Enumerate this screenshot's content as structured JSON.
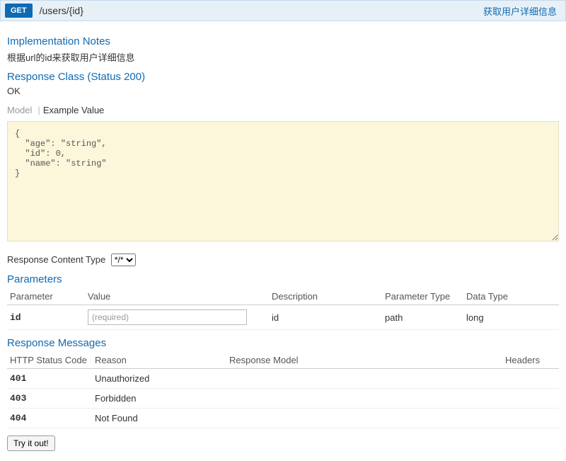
{
  "operation": {
    "method": "GET",
    "path": "/users/{id}",
    "summary": "获取用户详细信息"
  },
  "notes": {
    "heading": "Implementation Notes",
    "text": "根据url的id来获取用户详细信息"
  },
  "response_class": {
    "heading": "Response Class (Status 200)",
    "status_text": "OK",
    "tabs": {
      "model": "Model",
      "example": "Example Value"
    },
    "example": "{\n  \"age\": \"string\",\n  \"id\": 0,\n  \"name\": \"string\"\n}"
  },
  "content_type": {
    "label": "Response Content Type",
    "options": [
      "*/*"
    ],
    "selected": "*/*"
  },
  "parameters": {
    "heading": "Parameters",
    "columns": {
      "parameter": "Parameter",
      "value": "Value",
      "description": "Description",
      "param_type": "Parameter Type",
      "data_type": "Data Type"
    },
    "rows": [
      {
        "name": "id",
        "placeholder": "(required)",
        "value": "",
        "description": "id",
        "param_type": "path",
        "data_type": "long"
      }
    ]
  },
  "response_messages": {
    "heading": "Response Messages",
    "columns": {
      "code": "HTTP Status Code",
      "reason": "Reason",
      "model": "Response Model",
      "headers": "Headers"
    },
    "rows": [
      {
        "code": "401",
        "reason": "Unauthorized",
        "model": "",
        "headers": ""
      },
      {
        "code": "403",
        "reason": "Forbidden",
        "model": "",
        "headers": ""
      },
      {
        "code": "404",
        "reason": "Not Found",
        "model": "",
        "headers": ""
      }
    ]
  },
  "try_button": "Try it out!"
}
